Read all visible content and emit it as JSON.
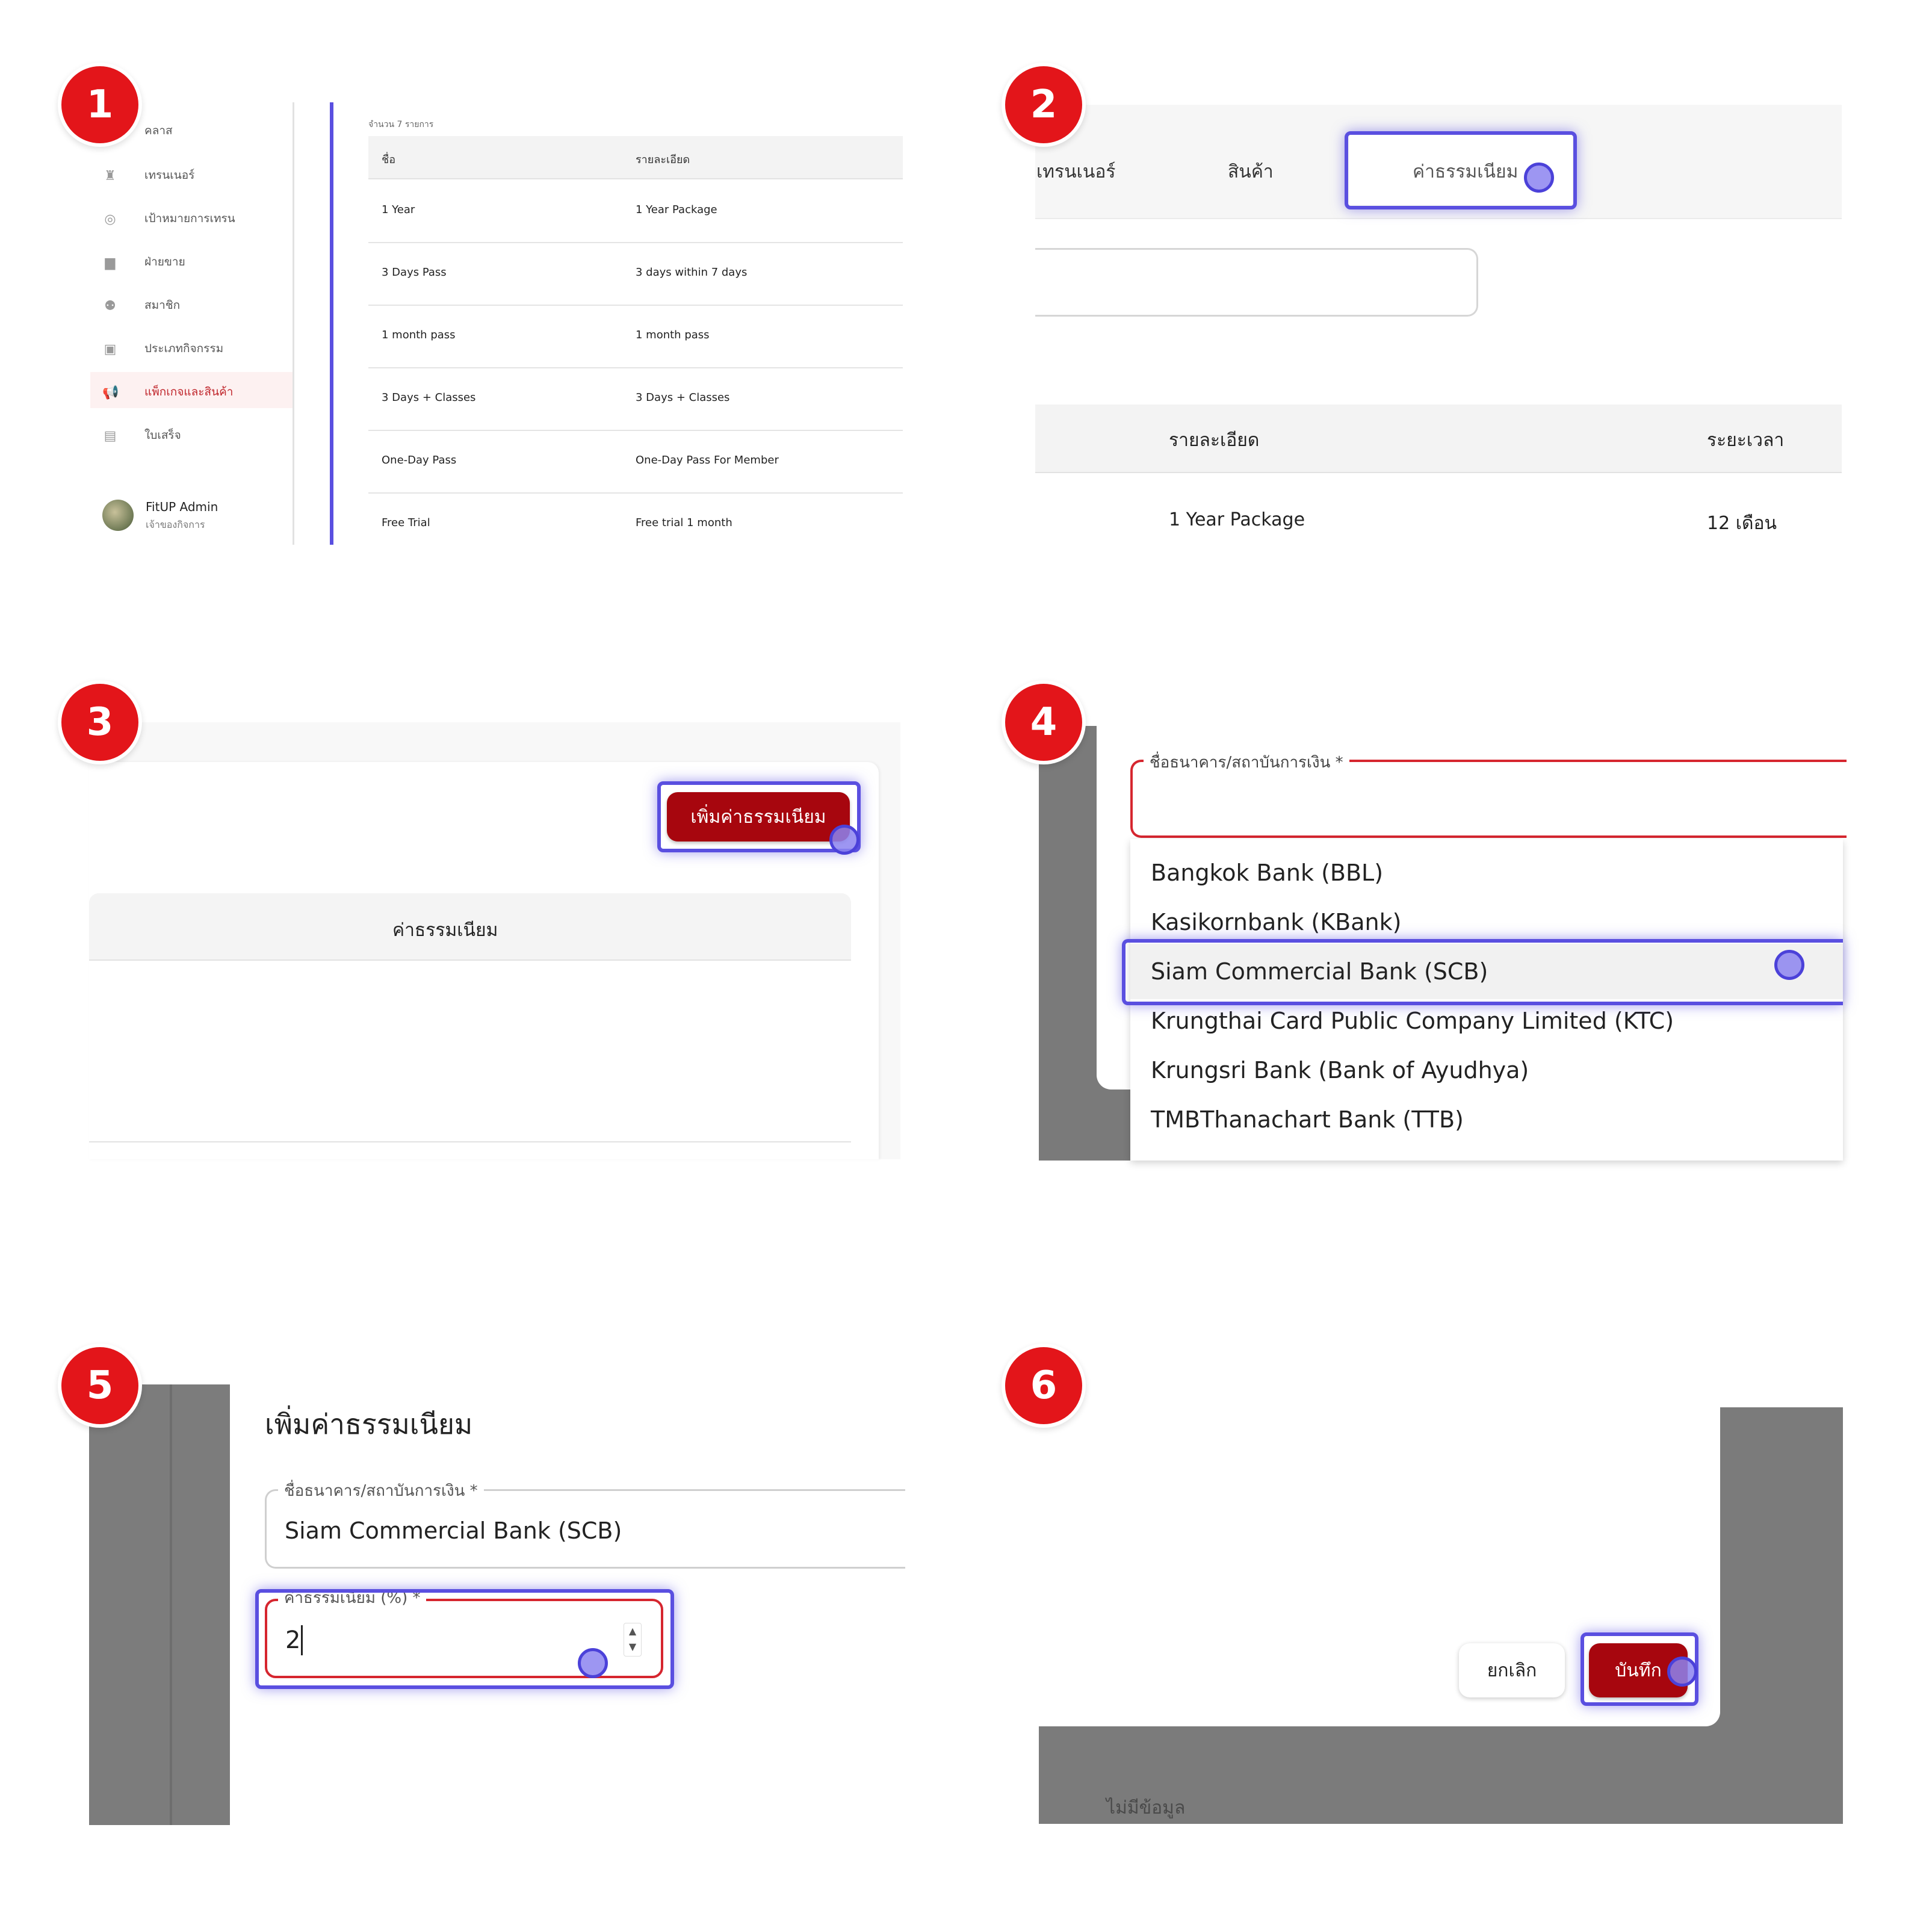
{
  "steps": [
    "1",
    "2",
    "3",
    "4",
    "5",
    "6"
  ],
  "panel1": {
    "sidebar": [
      {
        "label": "คลาส",
        "icon": "class-icon"
      },
      {
        "label": "เทรนเนอร์",
        "icon": "trainer-icon"
      },
      {
        "label": "เป้าหมายการเทรน",
        "icon": "target-icon"
      },
      {
        "label": "ฝ่ายขาย",
        "icon": "briefcase-icon"
      },
      {
        "label": "สมาชิก",
        "icon": "members-icon"
      },
      {
        "label": "ประเภทกิจกรรม",
        "icon": "activity-icon"
      },
      {
        "label": "แพ็กเกจและสินค้า",
        "icon": "megaphone-icon"
      },
      {
        "label": "ใบเสร็จ",
        "icon": "receipt-icon"
      }
    ],
    "user_name": "FitUP Admin",
    "user_role": "เจ้าของกิจการ",
    "count_text": "จำนวน 7 รายการ",
    "table_headers": [
      "ชื่อ",
      "รายละเอียด"
    ],
    "rows": [
      [
        "1 Year",
        "1 Year Package"
      ],
      [
        "3 Days Pass",
        "3 days within 7 days"
      ],
      [
        "1 month pass",
        "1 month pass"
      ],
      [
        "3 Days + Classes",
        "3 Days + Classes"
      ],
      [
        "One-Day Pass",
        "One-Day Pass For Member"
      ],
      [
        "Free Trial",
        "Free trial 1 month"
      ]
    ]
  },
  "panel2": {
    "tabs": [
      "เทรนเนอร์",
      "สินค้า",
      "ค่าธรรมเนียม"
    ],
    "table_headers": [
      "รายละเอียด",
      "ระยะเวลา"
    ],
    "row": [
      "1 Year Package",
      "12 เดือน"
    ]
  },
  "panel3": {
    "add_button": "เพิ่มค่าธรรมเนียม",
    "column_header": "ค่าธรรมเนียม"
  },
  "panel4": {
    "field_label": "ชื่อธนาคาร/สถาบันการเงิน *",
    "options": [
      "Bangkok Bank (BBL)",
      "Kasikornbank (KBank)",
      "Siam Commercial Bank (SCB)",
      "Krungthai Card Public Company Limited (KTC)",
      "Krungsri Bank (Bank of Ayudhya)",
      "TMBThanachart Bank (TTB)"
    ]
  },
  "panel5": {
    "title": "เพิ่มค่าธรรมเนียม",
    "bank_label": "ชื่อธนาคาร/สถาบันการเงิน *",
    "bank_value": "Siam Commercial Bank (SCB)",
    "fee_label": "ค่าธรรมเนียม (%) *",
    "fee_value": "2"
  },
  "panel6": {
    "cancel": "ยกเลิก",
    "save": "บันทึก",
    "empty": "ไม่มีข้อมูล"
  },
  "colors": {
    "badge": "#e3151a",
    "highlight": "#5a4fe0",
    "primary_button": "#a7060e",
    "error_border": "#d6262f"
  }
}
